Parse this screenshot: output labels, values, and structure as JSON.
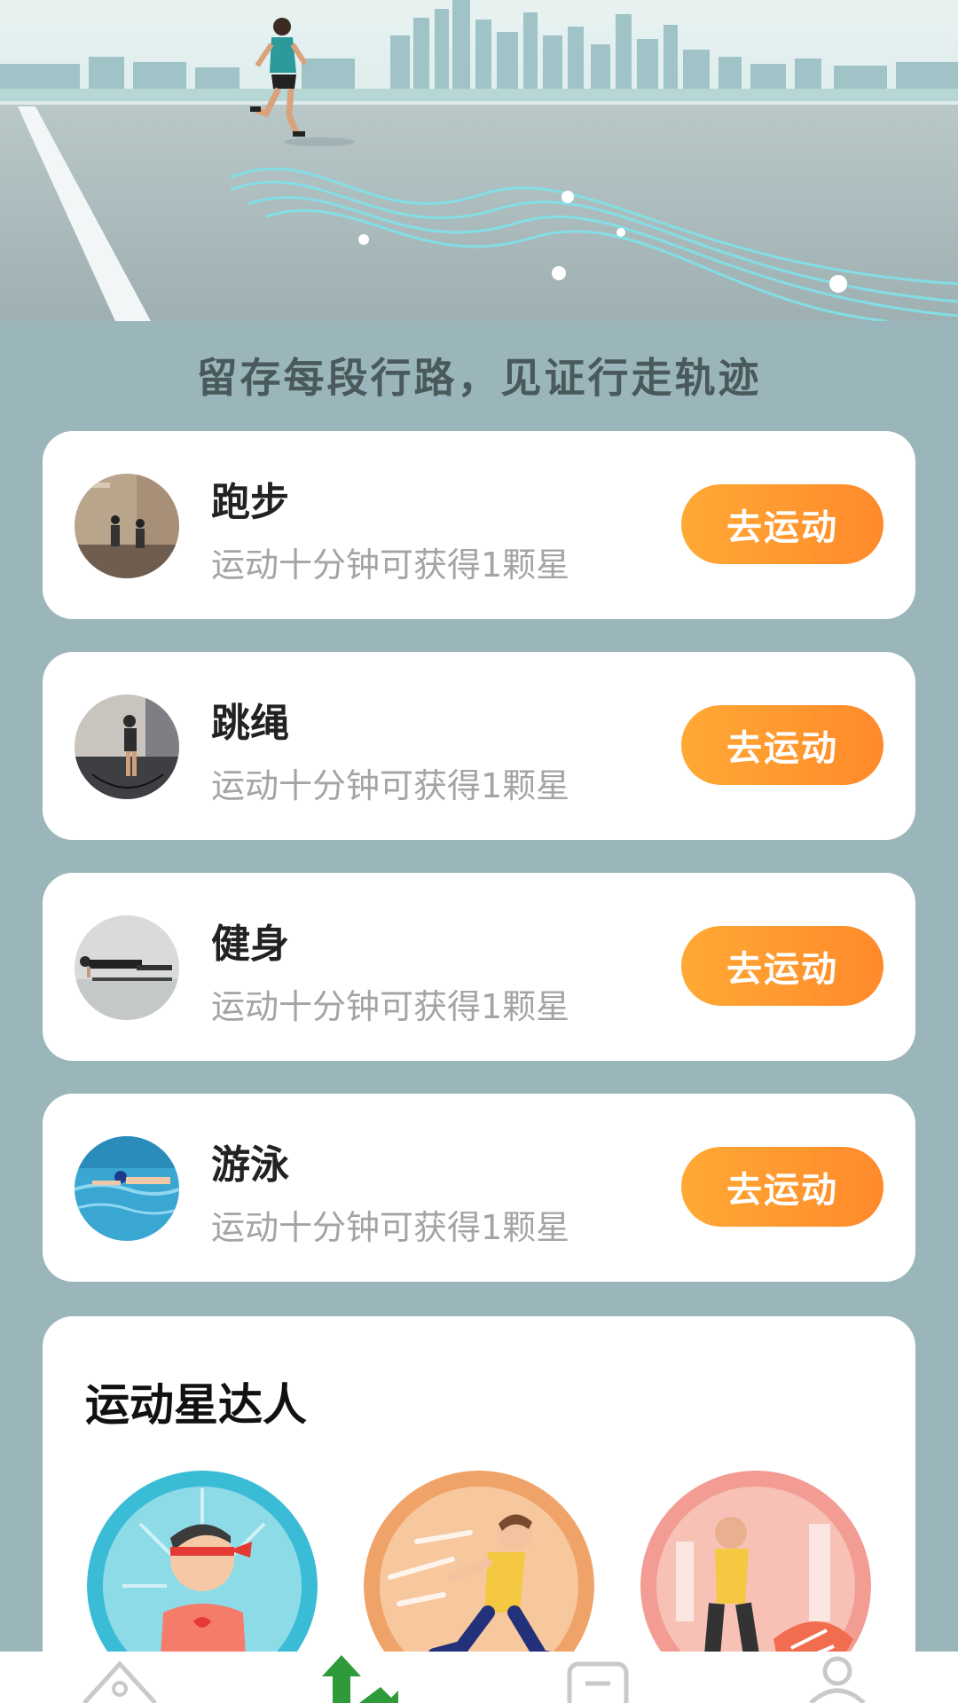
{
  "hero": {
    "slogan": "留存每段行路，见证行走轨迹"
  },
  "activities": [
    {
      "title": "跑步",
      "subtitle": "运动十分钟可获得1颗星",
      "button": "去运动",
      "icon": "running-photo"
    },
    {
      "title": "跳绳",
      "subtitle": "运动十分钟可获得1颗星",
      "button": "去运动",
      "icon": "jump-rope-photo"
    },
    {
      "title": "健身",
      "subtitle": "运动十分钟可获得1颗星",
      "button": "去运动",
      "icon": "fitness-plank-photo"
    },
    {
      "title": "游泳",
      "subtitle": "运动十分钟可获得1颗星",
      "button": "去运动",
      "icon": "swimming-photo"
    }
  ],
  "stars": {
    "title": "运动星达人",
    "medals": [
      "headband-athlete-badge",
      "runner-badge",
      "sprinter-badge"
    ]
  },
  "tabbar": {
    "icons": [
      "home-icon",
      "sport-active-icon",
      "list-icon",
      "profile-icon"
    ]
  },
  "colors": {
    "background": "#9bb6bb",
    "button_start": "#ffa935",
    "button_end": "#ff8a2b",
    "tab_active": "#2e9a3a"
  }
}
